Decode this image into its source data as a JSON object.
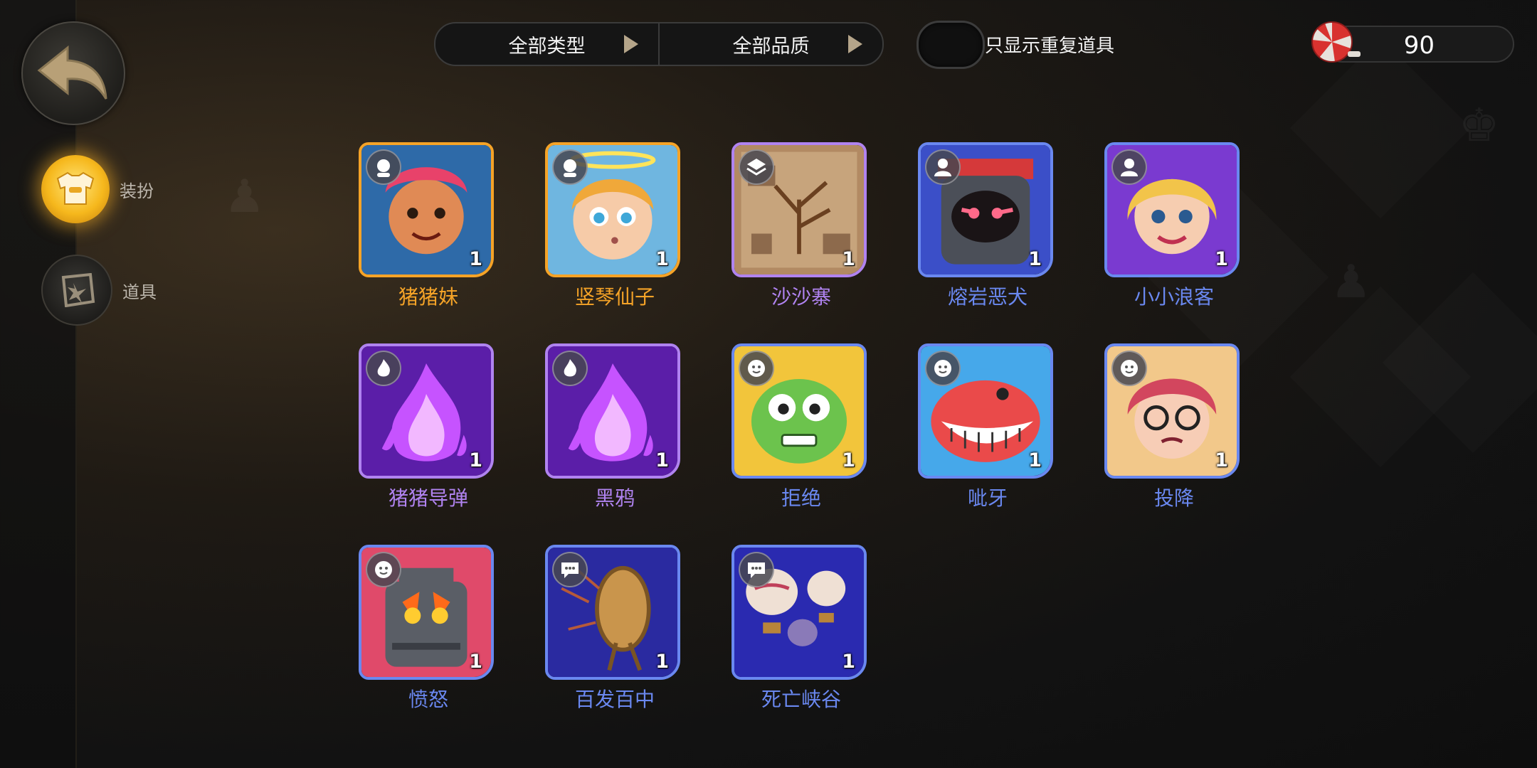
{
  "sidebar": {
    "nav": [
      {
        "label": "装扮",
        "icon": "costume-icon",
        "active": true
      },
      {
        "label": "道具",
        "icon": "props-icon",
        "active": false
      }
    ]
  },
  "filters": {
    "type_label": "全部类型",
    "quality_label": "全部品质"
  },
  "toggle": {
    "label": "只显示重复道具",
    "on": false
  },
  "currency": {
    "icon": "candy-icon",
    "value": "90"
  },
  "colors": {
    "gold": "#f5a327",
    "purple": "#b083f0",
    "blue": "#6a88f0"
  },
  "items": [
    {
      "name": "猪猪妹",
      "count": "1",
      "rarity": "gold",
      "type_icon": "hero-icon",
      "art": "pink-hair-girl"
    },
    {
      "name": "竖琴仙子",
      "count": "1",
      "rarity": "gold",
      "type_icon": "hero-icon",
      "art": "halo-fairy"
    },
    {
      "name": "沙沙寨",
      "count": "1",
      "rarity": "purple",
      "type_icon": "board-icon",
      "art": "desert-fort"
    },
    {
      "name": "熔岩恶犬",
      "count": "1",
      "rarity": "blue",
      "type_icon": "avatar-icon",
      "art": "lava-hound"
    },
    {
      "name": "小小浪客",
      "count": "1",
      "rarity": "blue",
      "type_icon": "avatar-icon",
      "art": "blonde-girl"
    },
    {
      "name": "猪猪导弹",
      "count": "1",
      "rarity": "purple",
      "type_icon": "flame-icon",
      "art": "purple-fire"
    },
    {
      "name": "黑鸦",
      "count": "1",
      "rarity": "purple",
      "type_icon": "flame-icon",
      "art": "purple-fire"
    },
    {
      "name": "拒绝",
      "count": "1",
      "rarity": "blue",
      "type_icon": "emote-icon",
      "art": "goblin-face"
    },
    {
      "name": "呲牙",
      "count": "1",
      "rarity": "blue",
      "type_icon": "emote-icon",
      "art": "red-dino-grin"
    },
    {
      "name": "投降",
      "count": "1",
      "rarity": "blue",
      "type_icon": "emote-icon",
      "art": "glasses-girl"
    },
    {
      "name": "愤怒",
      "count": "1",
      "rarity": "blue",
      "type_icon": "emote-icon",
      "art": "angry-tower"
    },
    {
      "name": "百发百中",
      "count": "1",
      "rarity": "blue",
      "type_icon": "chat-icon",
      "art": "target-arrows"
    },
    {
      "name": "死亡峡谷",
      "count": "1",
      "rarity": "blue",
      "type_icon": "chat-icon",
      "art": "balloons"
    }
  ]
}
